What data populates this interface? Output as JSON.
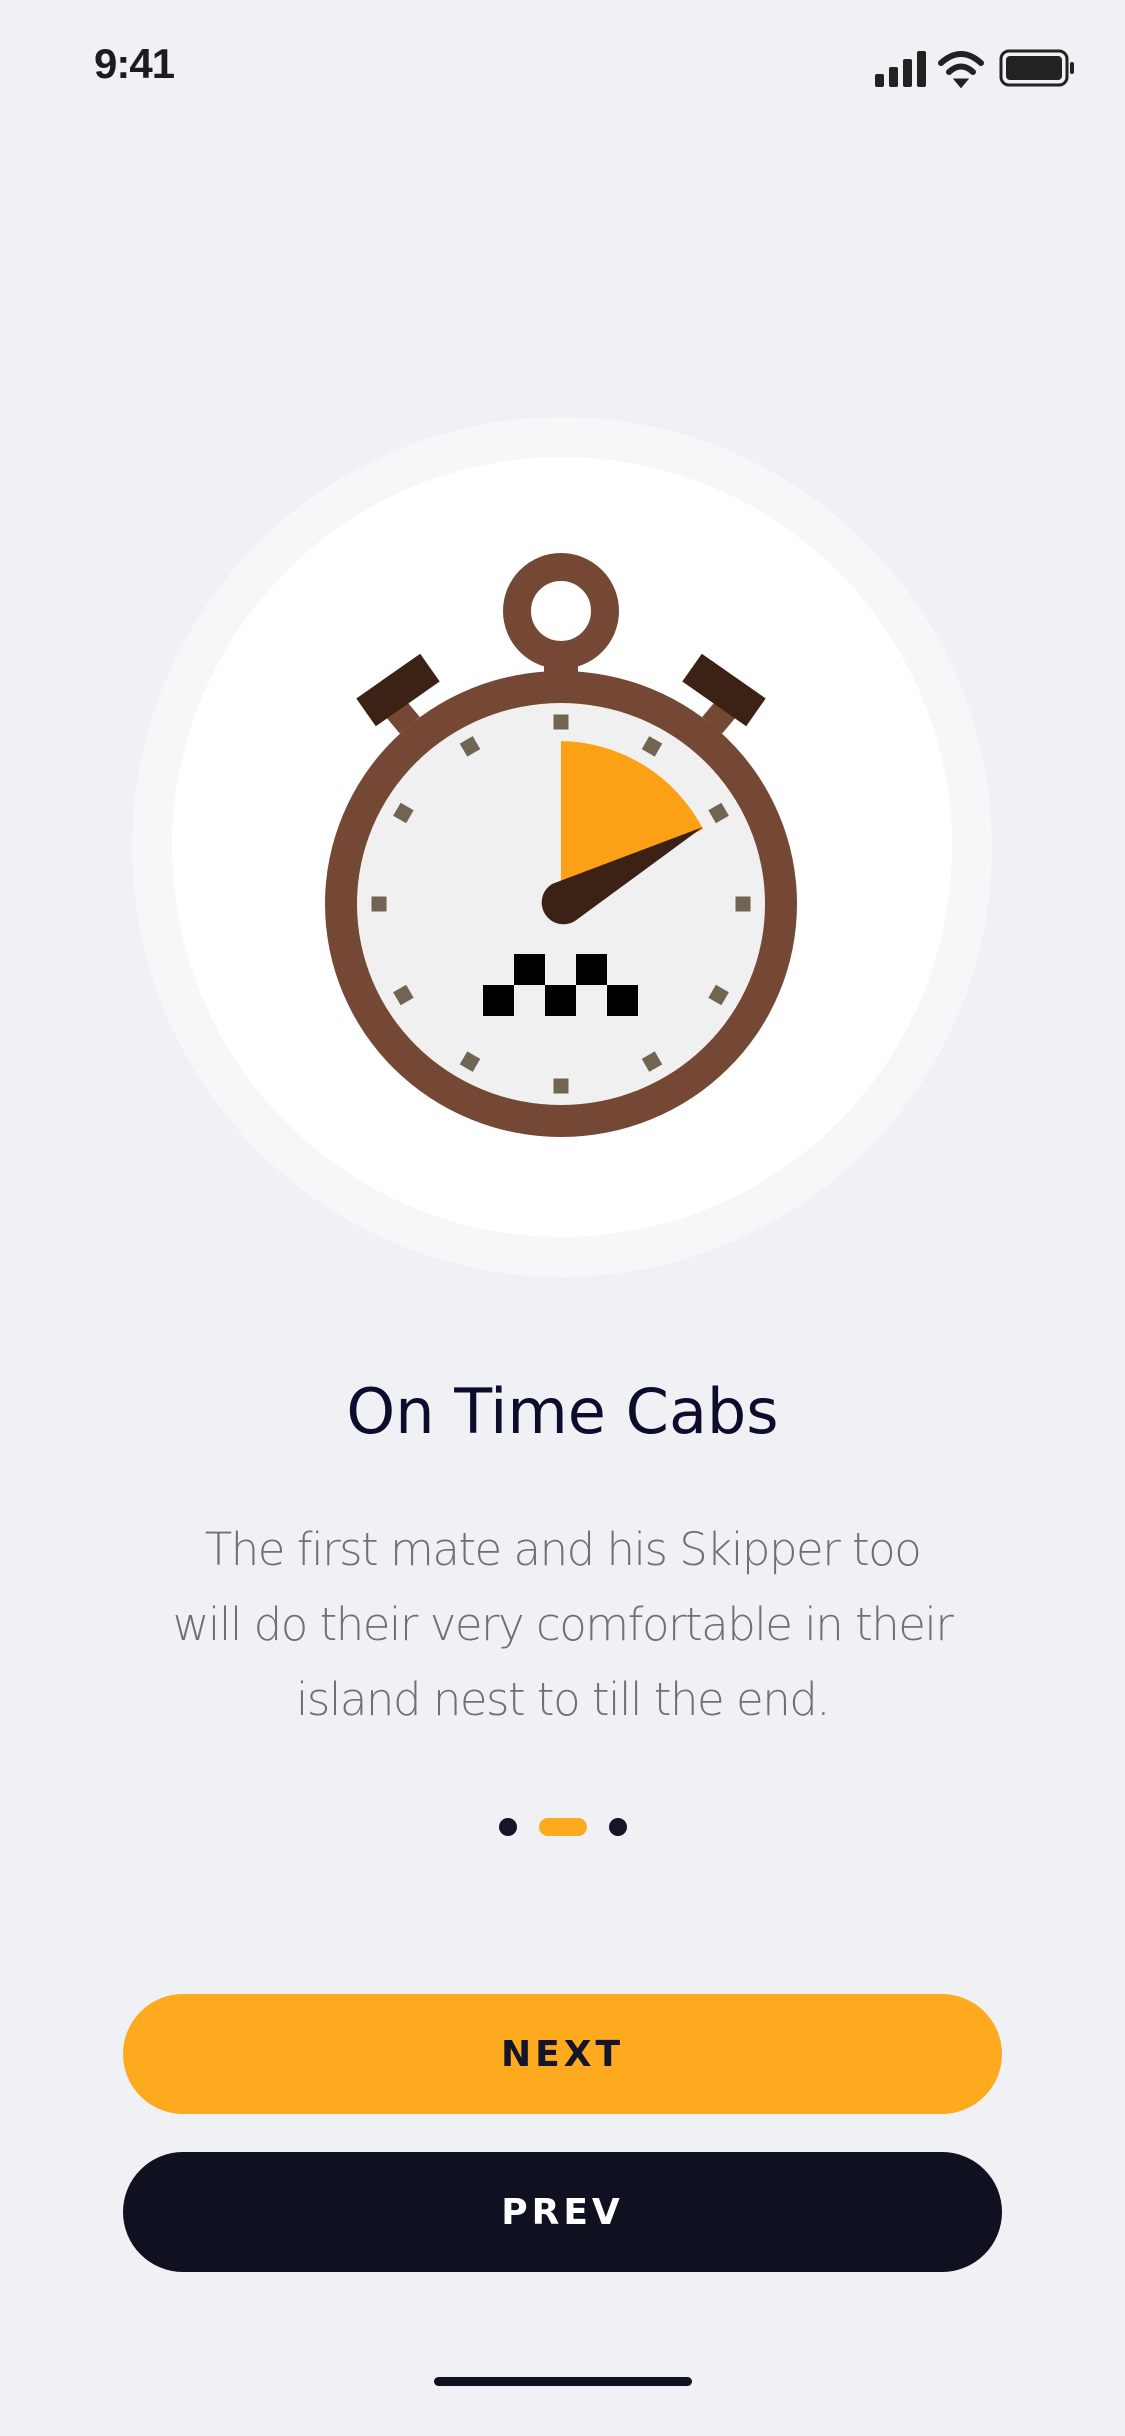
{
  "status_bar": {
    "time": "9:41",
    "icons": [
      "signal-icon",
      "wifi-icon",
      "battery-icon"
    ]
  },
  "illustration": {
    "name": "stopwatch-taxi-icon"
  },
  "onboarding": {
    "title": "On Time Cabs",
    "description_lines": [
      "The first mate and his Skipper too",
      "will do their very comfortable in their",
      "island nest to till the end."
    ],
    "page_indicator": {
      "total": 3,
      "current": 2
    }
  },
  "buttons": {
    "next": "NEXT",
    "prev": "PREV"
  },
  "colors": {
    "accent": "#fdaa1f",
    "dark": "#0f1020",
    "background": "#f0f1f5",
    "stopwatch": "#744835"
  }
}
